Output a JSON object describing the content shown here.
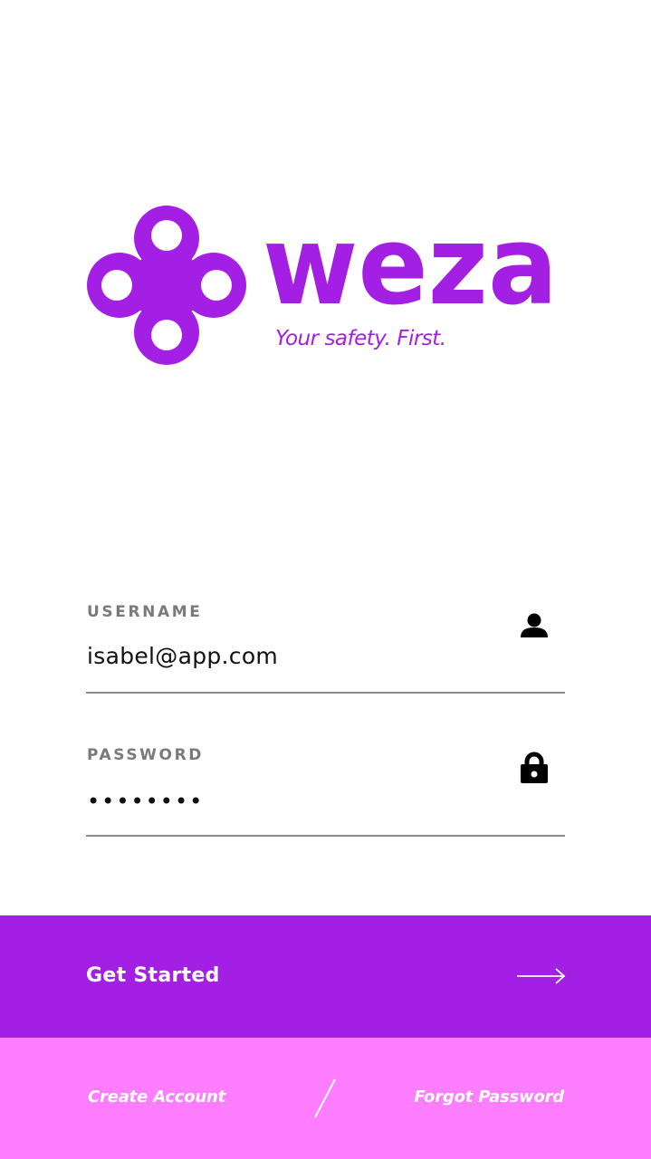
{
  "brand": {
    "name": "weza",
    "tagline": "Your safety. First.",
    "logo_icon": "four-petal-ring-logo-icon"
  },
  "login_form": {
    "username": {
      "label": "USERNAME",
      "value": "isabel@app.com",
      "icon": "user-icon"
    },
    "password": {
      "label": "PASSWORD",
      "masked_value": "••••••••",
      "icon": "lock-icon"
    }
  },
  "cta": {
    "label": "Get Started",
    "icon": "arrow-right-icon"
  },
  "footer": {
    "create_account_label": "Create Account",
    "forgot_password_label": "Forgot Password",
    "divider_icon": "slash-divider-icon"
  },
  "colors": {
    "brand_purple": "#A31FE4",
    "cta_background": "#A41FE4",
    "footer_background": "#FF7EFF",
    "label_gray": "#7A7A7A",
    "underline_gray": "#8A8A8A",
    "text_dark": "#111111"
  }
}
